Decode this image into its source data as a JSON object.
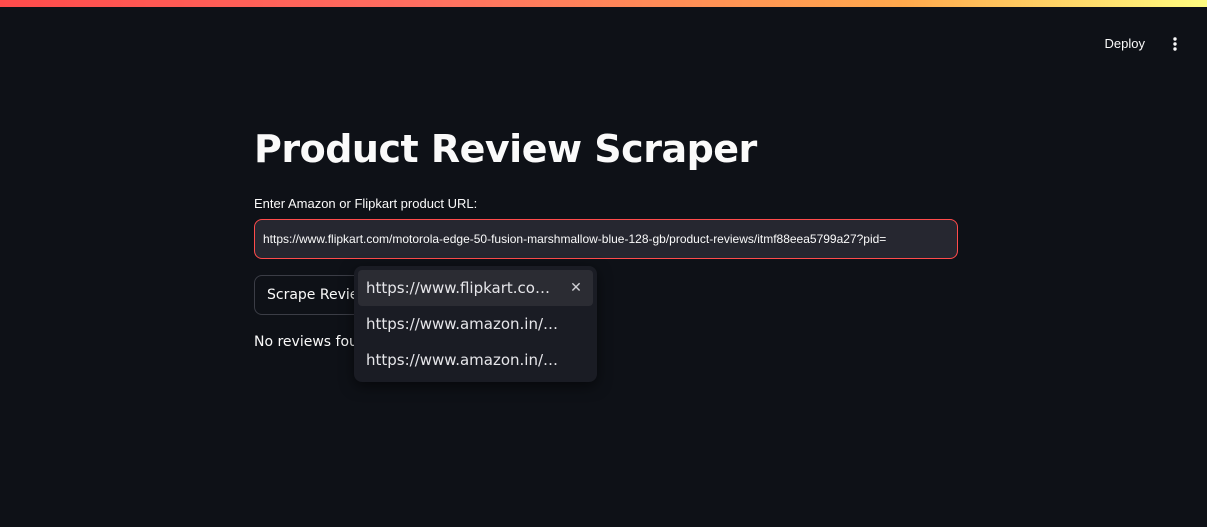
{
  "header": {
    "deploy_label": "Deploy",
    "menu_icon": "vertical-ellipsis-icon"
  },
  "main": {
    "title": "Product Review Scraper",
    "url_label": "Enter Amazon or Flipkart product URL:",
    "url_value": "https://www.flipkart.com/motorola-edge-50-fusion-marshmallow-blue-128-gb/product-reviews/itmf88eea5799a27?pid=",
    "scrape_button_label": "Scrape Revie",
    "status_text": "No reviews four"
  },
  "suggestions": {
    "items": [
      {
        "label": "https://www.flipkart.co…",
        "active": true,
        "remove_icon": "close-icon",
        "remove_glyph": "✕"
      },
      {
        "label": "https://www.amazon.in/…"
      },
      {
        "label": "https://www.amazon.in/…"
      }
    ]
  },
  "colors": {
    "background": "#0e1117",
    "input_background": "#262730",
    "accent_border": "#ff4b4b",
    "popup_background": "#1a1c24"
  }
}
